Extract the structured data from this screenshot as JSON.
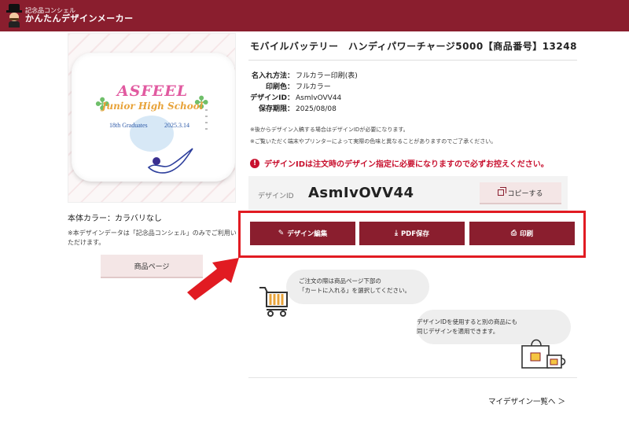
{
  "header": {
    "logo_small": "記念品コンシェル",
    "logo_big": "かんたんデザインメーカー"
  },
  "preview": {
    "design_title": "ASFEEL",
    "design_subtitle": "Junior High School",
    "design_graduates": "18th Graduates",
    "design_date": "2025.3.14"
  },
  "left": {
    "body_color": "本体カラー：カラバリなし",
    "note": "※本デザインデータは「記念品コンシェル」のみでご利用いただけます。",
    "product_page_button": "商品ページ"
  },
  "product": {
    "title": "モバイルバッテリー　ハンディパワーチャージ5000【商品番号】13248",
    "info": [
      {
        "label": "名入れ方法：",
        "value": "フルカラー印刷(表)"
      },
      {
        "label": "印刷色：",
        "value": "フルカラー"
      },
      {
        "label": "デザインID：",
        "value": "AsmIvOVV44"
      },
      {
        "label": "保存期限：",
        "value": "2025/08/08"
      }
    ],
    "notes": [
      "※後からデザイン入稿する場合はデザインIDが必要になります。",
      "※ご覧いただく端末やプリンターによって実際の色味と異なることがありますのでご了承ください。"
    ],
    "warning": "デザインIDは注文時のデザイン指定に必要になりますので必ずお控えください。"
  },
  "design_id_box": {
    "label": "デザインID",
    "value": "AsmIvOVV44",
    "copy_button": "コピーする"
  },
  "actions": {
    "edit": "デザイン編集",
    "pdf": "PDF保存",
    "print": "印刷"
  },
  "tips": {
    "bubble1_line1": "ご注文の際は商品ページ下部の",
    "bubble1_line2": "「カートに入れる」を選択してください。",
    "bubble2_line1": "デザインIDを使用すると別の商品にも",
    "bubble2_line2": "同じデザインを適用できます。"
  },
  "footer": {
    "my_design_link": "マイデザイン一覧へ ＞"
  },
  "colors": {
    "brand": "#8a1e2e",
    "warning": "#c8102e",
    "highlight": "#e11b22"
  }
}
